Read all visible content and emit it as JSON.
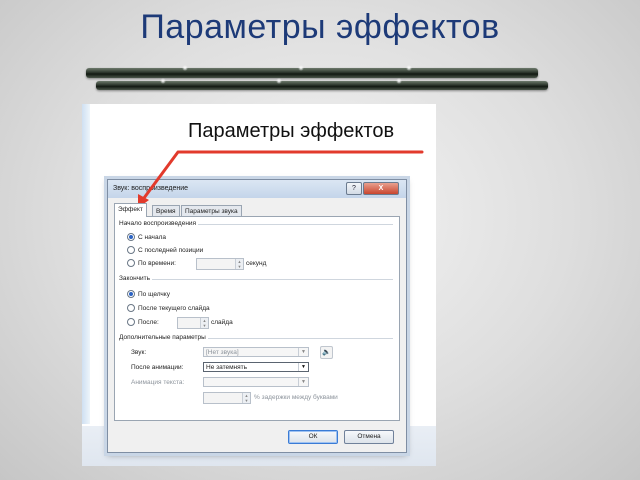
{
  "slide": {
    "title": "Параметры эффектов"
  },
  "screenshot": {
    "heading": "Параметры эффектов"
  },
  "dialog": {
    "title": "Звук: воспроизведение",
    "help_label": "?",
    "close_label": "X",
    "tabs": [
      {
        "label": "Эффект",
        "active": true
      },
      {
        "label": "Время",
        "active": false
      },
      {
        "label": "Параметры звука",
        "active": false
      }
    ],
    "start": {
      "group_title": "Начало воспроизведения",
      "options": [
        {
          "label": "С начала",
          "selected": true
        },
        {
          "label": "С последней позиции",
          "selected": false
        },
        {
          "label": "По времени:",
          "selected": false
        }
      ],
      "time_unit": "секунд"
    },
    "stop": {
      "group_title": "Закончить",
      "options": [
        {
          "label": "По щелчку",
          "selected": true
        },
        {
          "label": "После текущего слайда",
          "selected": false
        },
        {
          "label": "После:",
          "selected": false
        }
      ],
      "slides_unit": "слайда"
    },
    "extra": {
      "group_title": "Дополнительные параметры",
      "sound_label": "Звук:",
      "sound_value": "[Нет звука]",
      "after_anim_label": "После анимации:",
      "after_anim_value": "Не затемнять",
      "anim_text_label": "Анимация текста:",
      "delay_label": "% задержки между буквами"
    },
    "buttons": {
      "ok": "ОК",
      "cancel": "Отмена"
    }
  }
}
